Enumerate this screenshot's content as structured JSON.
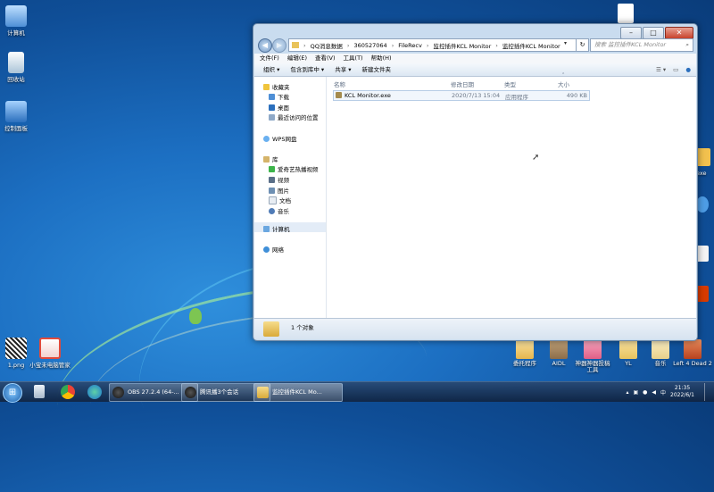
{
  "desktop": {
    "left_icons": [
      {
        "label": "计算机",
        "color": "#6aa7e0"
      },
      {
        "label": "回收站",
        "color": "#d7e6f0"
      },
      {
        "label": "控制面板",
        "color": "#4e8fd6"
      }
    ],
    "bottom_left_icons": [
      {
        "label": "1.png",
        "color": "#e8e8e8"
      },
      {
        "label": "小宝未电脑管家",
        "color": "#e24a3b"
      }
    ],
    "bottom_right_icons": [
      {
        "label": "委托程序",
        "color": "#e6b64d"
      },
      {
        "label": "AIDL",
        "color": "#8c6d4a"
      },
      {
        "label": "神器神器投稿工具",
        "color": "#e25f86"
      },
      {
        "label": "YL",
        "color": "#e8c35e"
      },
      {
        "label": "音乐",
        "color": "#e8d08a"
      },
      {
        "label": "Left 4 Dead 2",
        "color": "#b8421f"
      }
    ],
    "right_edge_label": "exe"
  },
  "window": {
    "nav_back": "◀",
    "nav_forward": "▶",
    "breadcrumb": [
      "QQ消息数据",
      "360527064",
      "FileRecv",
      "监控插件KCL Monitor",
      "监控插件KCL Monitor"
    ],
    "search_placeholder": "搜索 监控插件KCL Monitor",
    "menu": [
      "文件(F)",
      "编辑(E)",
      "查看(V)",
      "工具(T)",
      "帮助(H)"
    ],
    "commands": [
      "组织 ▾",
      "包含到库中 ▾",
      "共享 ▾",
      "新建文件夹"
    ],
    "nav": {
      "favorites_header": "收藏夹",
      "favorites": [
        "下载",
        "桌面",
        "最近访问的位置"
      ],
      "wps": "WPS网盘",
      "libraries_header": "库",
      "libraries": [
        "爱奇艺热播视频",
        "视频",
        "图片",
        "文档",
        "音乐"
      ],
      "computer": "计算机",
      "network": "网络"
    },
    "columns": {
      "name": "名称",
      "modified": "修改日期",
      "type": "类型",
      "size": "大小"
    },
    "files": [
      {
        "name": "KCL Monitor.exe",
        "modified": "2020/7/13 15:04",
        "type": "应用程序",
        "size": "490 KB"
      }
    ],
    "status": "1 个对象"
  },
  "taskbar": {
    "start_glyph": "⊞",
    "buttons": [
      "OBS 27.2.4 (64-...",
      "腾讯播3个会话",
      "监控插件KCL Mo..."
    ],
    "clock_time": "21:35",
    "clock_date": "2022/6/1"
  },
  "colors": {
    "accent": "#1c6fc2",
    "window_frame": "#c9dcef"
  }
}
